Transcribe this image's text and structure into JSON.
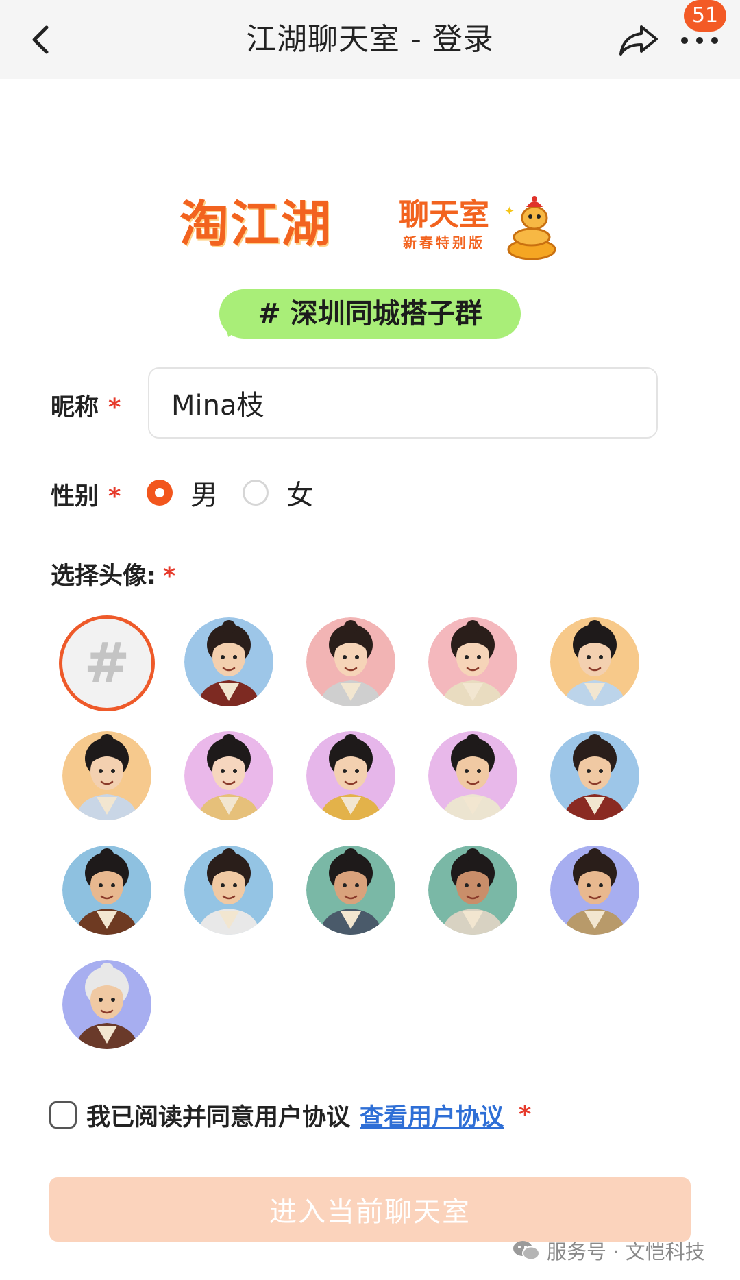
{
  "navbar": {
    "title": "江湖聊天室 - 登录",
    "badge_count": "51",
    "icons": [
      "back-icon",
      "share-icon",
      "more-icon"
    ]
  },
  "logo": {
    "main": "淘江湖",
    "sub": "聊天室",
    "sub2": "新春特别版"
  },
  "group_tag": "# 深圳同城搭子群",
  "form": {
    "nickname_label": "昵称",
    "nickname_value": "Mina枝",
    "gender_label": "性别",
    "gender_options": [
      "男",
      "女"
    ],
    "gender_selected": "男",
    "avatar_label": "选择头像:",
    "required_mark": "*",
    "avatar_placeholder": "#",
    "avatar_count": 16,
    "selected_avatar": 0
  },
  "agreement": {
    "text": "我已阅读并同意用户协议",
    "link": "查看用户协议",
    "checked": false
  },
  "submit_label": "进入当前聊天室",
  "watermark": "服务号 · 文恺科技",
  "colors": {
    "accent": "#f2561d",
    "required": "#e63a2b",
    "tag_bg": "#a9ee78",
    "link": "#2f6fd6",
    "submit_disabled_bg": "#fbd3bc"
  }
}
